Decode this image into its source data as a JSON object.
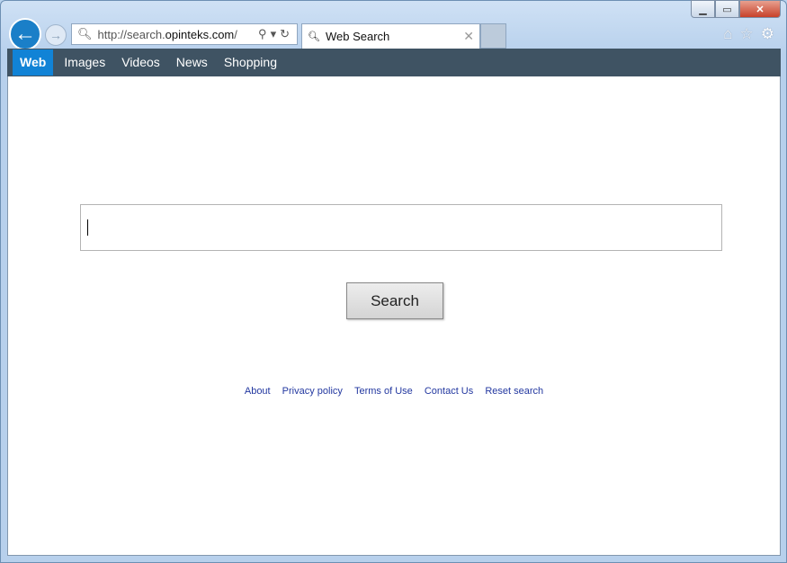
{
  "browser": {
    "url_prefix": "http://search.",
    "url_domain": "opinteks.com",
    "url_suffix": "/",
    "tab_title": "Web Search",
    "icons": [
      "back-icon",
      "forward-icon",
      "search-icon",
      "refresh-icon",
      "close-tab-icon",
      "home-icon",
      "star-icon",
      "gear-icon",
      "minimize-icon",
      "maximize-icon",
      "close-icon"
    ]
  },
  "nav": {
    "items": [
      "Web",
      "Images",
      "Videos",
      "News",
      "Shopping"
    ],
    "active": "Web"
  },
  "search": {
    "value": "",
    "button_label": "Search"
  },
  "footer": {
    "links": [
      "About",
      "Privacy policy",
      "Terms of Use",
      "Contact Us",
      "Reset search"
    ]
  },
  "colors": {
    "nav_bg": "#3f5363",
    "nav_active": "#1183d6",
    "link": "#2338a0"
  }
}
